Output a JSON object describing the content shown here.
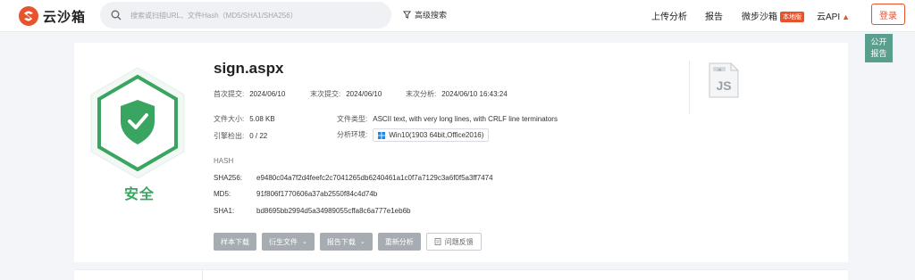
{
  "header": {
    "logo_text": "云沙箱",
    "search_placeholder": "搜索或扫描URL、文件Hash（MD5/SHA1/SHA256）",
    "advanced_search": "高级搜索",
    "nav": {
      "upload": "上传分析",
      "report": "报告",
      "micro_sandbox": "微步沙箱",
      "local_badge": "本地版",
      "cloud_api": "云API",
      "login": "登录"
    }
  },
  "float_button": {
    "line1": "公开",
    "line2": "报告"
  },
  "verdict": {
    "text": "安全",
    "color": "#3aa560"
  },
  "file": {
    "name": "sign.aspx",
    "first_submit_label": "首次提交:",
    "first_submit": "2024/06/10",
    "last_submit_label": "末次提交:",
    "last_submit": "2024/06/10",
    "last_analysis_label": "末次分析:",
    "last_analysis": "2024/06/10 16:43:24",
    "size_label": "文件大小:",
    "size": "5.08 KB",
    "type_label": "文件类型:",
    "type": "ASCII text, with very long lines, with CRLF line terminators",
    "engine_label": "引擎检出:",
    "engine": "0 / 22",
    "env_label": "分析环境:",
    "env": "Win10(1903 64bit,Office2016)",
    "type_icon": "JS"
  },
  "hash": {
    "title": "HASH",
    "sha256_label": "SHA256:",
    "sha256": "e9480c04a7f2d4feefc2c7041265db6240461a1c0f7a7129c3a6f0f5a3ff7474",
    "md5_label": "MD5:",
    "md5": "91f806f1770606a37ab2550f84c4d74b",
    "sha1_label": "SHA1:",
    "sha1": "bd8695bb2994d5a34989055cffa8c6a777e1eb6b"
  },
  "actions": {
    "sample_download": "样本下载",
    "derived_files": "衍生文件",
    "report_download": "报告下载",
    "reanalyze": "重新分析",
    "feedback": "问题反馈"
  },
  "colors": {
    "accent": "#e8532c",
    "safe": "#3aa560",
    "float_bg": "#5a9e8d"
  }
}
